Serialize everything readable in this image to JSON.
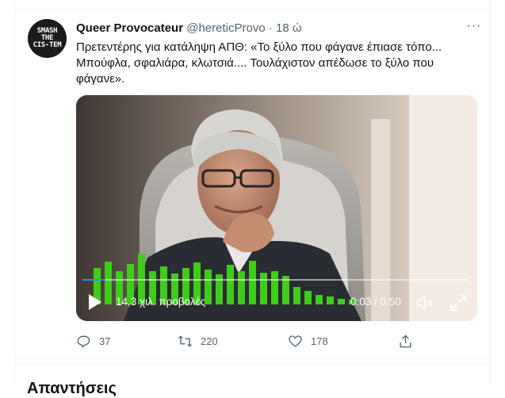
{
  "tweet": {
    "author_name": "Queer Provocateur",
    "author_handle": "@hereticProvo",
    "separator": "·",
    "time": "18 ώ",
    "more_label": "···",
    "text": "Πρετεντέρης για κατάληψη ΑΠΘ: «Το ξύλο που φάγανε έπιασε τόπο... Μπούφλα, σφαλιάρα, κλωτσιά.... Τουλάχιστον απέδωσε το ξύλο που φάγανε».",
    "avatar_text": [
      "SMASH",
      "THE",
      "CIS-TEM"
    ],
    "avatar_icon": "smash-the-cistem-avatar"
  },
  "video": {
    "views": "14,3 χιλ. προβολές",
    "time": "0:03 / 0:50",
    "progress": 0.06,
    "accent": "#1d9bf0",
    "icons": [
      "play-icon",
      "mute-icon",
      "fullscreen-icon"
    ]
  },
  "actions": {
    "replies": "37",
    "retweets": "220",
    "likes": "178",
    "icons": [
      "reply-icon",
      "retweet-icon",
      "like-icon",
      "share-icon"
    ]
  },
  "next_section": {
    "title": "Απαντήσεις"
  }
}
